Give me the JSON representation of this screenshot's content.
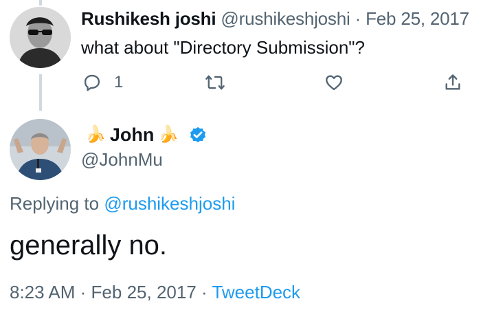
{
  "parent_tweet": {
    "name": "Rushikesh joshi",
    "handle": "@rushikeshjoshi",
    "separator": "·",
    "date": "Feb 25, 2017",
    "text": "what about \"Directory Submission\"?",
    "reply_count": "1",
    "icons": [
      "reply-icon",
      "retweet-icon",
      "like-icon",
      "share-icon"
    ]
  },
  "main_tweet": {
    "name": "John",
    "handle": "@JohnMu",
    "name_emoji": "🍌",
    "verified": true,
    "replying_prefix": "Replying to",
    "replying_to": "@rushikeshjoshi",
    "text": "generally no.",
    "time": "8:23 AM",
    "date": "Feb 25, 2017",
    "separator": "·",
    "source": "TweetDeck"
  },
  "colors": {
    "link": "#1d9bf0",
    "muted": "#536471",
    "text": "#0f1419",
    "thread_line": "#cfd9de"
  }
}
